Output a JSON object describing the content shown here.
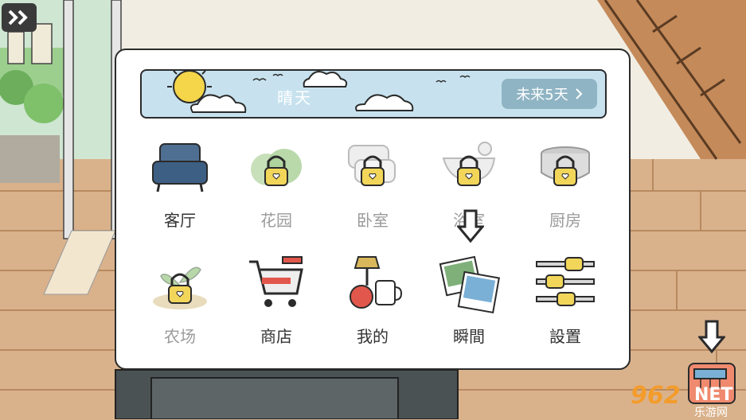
{
  "top_left_button": {
    "icon": "double-chevron-right-icon"
  },
  "weather": {
    "condition": "晴天",
    "forecast_label": "未来5天",
    "forecast_icon": "chevron-right-icon"
  },
  "menu": {
    "items": [
      {
        "label": "客厅",
        "locked": false,
        "icon": "armchair-icon"
      },
      {
        "label": "花园",
        "locked": true,
        "icon": "bush-icon"
      },
      {
        "label": "卧室",
        "locked": true,
        "icon": "pillows-icon"
      },
      {
        "label": "浴室",
        "locked": true,
        "icon": "bathtub-icon"
      },
      {
        "label": "厨房",
        "locked": true,
        "icon": "cooking-pot-icon"
      },
      {
        "label": "农场",
        "locked": true,
        "icon": "sprout-icon"
      },
      {
        "label": "商店",
        "locked": false,
        "icon": "shopping-cart-icon"
      },
      {
        "label": "我的",
        "locked": false,
        "icon": "lamp-apple-mug-icon"
      },
      {
        "label": "瞬間",
        "locked": false,
        "icon": "photos-icon"
      },
      {
        "label": "設置",
        "locked": false,
        "icon": "sliders-icon"
      }
    ]
  },
  "watermark": {
    "text": "962",
    "subtext": "NET",
    "caption": "乐游网"
  },
  "colors": {
    "sky": "#c7e2ee",
    "forecast": "#8fb4c4",
    "lock": "#f2d65a",
    "floor": "#d9b28c"
  }
}
